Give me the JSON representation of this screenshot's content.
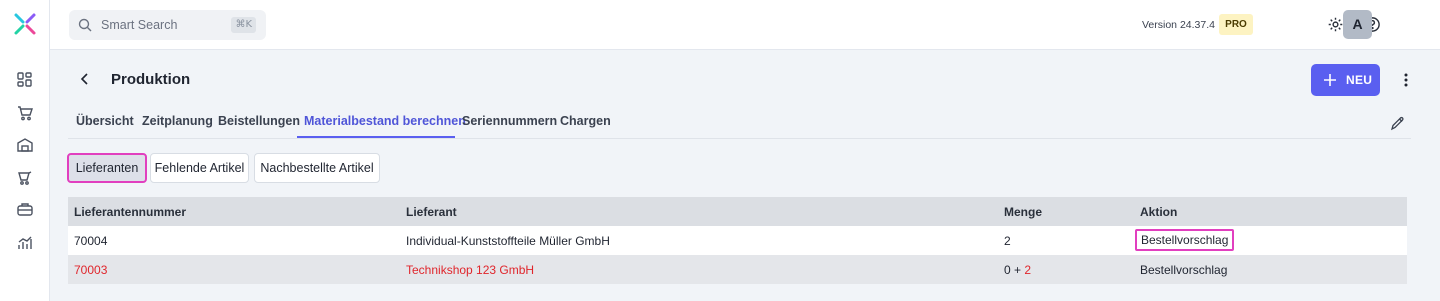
{
  "app": {
    "search": {
      "placeholder": "Smart Search",
      "shortcut": "⌘K"
    },
    "version": "Version 24.37.4",
    "plan_badge": "PRO",
    "avatar_initial": "A",
    "accent_color": "#5a5ff0",
    "highlight_color": "#e13fbf"
  },
  "sidebar": {
    "icons": [
      "dashboard-icon",
      "cart-icon",
      "warehouse-icon",
      "sales-icon",
      "production-icon",
      "analytics-icon"
    ]
  },
  "page": {
    "title": "Produktion",
    "new_label": "NEU"
  },
  "tabs": [
    {
      "label": "Übersicht"
    },
    {
      "label": "Zeitplanung"
    },
    {
      "label": "Beistellungen"
    },
    {
      "label": "Materialbestand berechnen",
      "active": true
    },
    {
      "label": "Seriennummern"
    },
    {
      "label": "Chargen"
    }
  ],
  "subtabs": [
    {
      "label": "Lieferanten",
      "active": true
    },
    {
      "label": "Fehlende Artikel"
    },
    {
      "label": "Nachbestellte Artikel"
    }
  ],
  "table": {
    "headers": [
      "Lieferantennummer",
      "Lieferant",
      "Menge",
      "Aktion"
    ],
    "rows": [
      {
        "nummer": "70004",
        "lieferant": "Individual-Kunststoffteile Müller GmbH",
        "menge": "2",
        "aktion": "Bestellvorschlag"
      },
      {
        "nummer": "70003",
        "lieferant": "Technikshop 123 GmbH",
        "menge_base": "0 + ",
        "menge_extra": "2",
        "aktion": "Bestellvorschlag"
      }
    ]
  }
}
